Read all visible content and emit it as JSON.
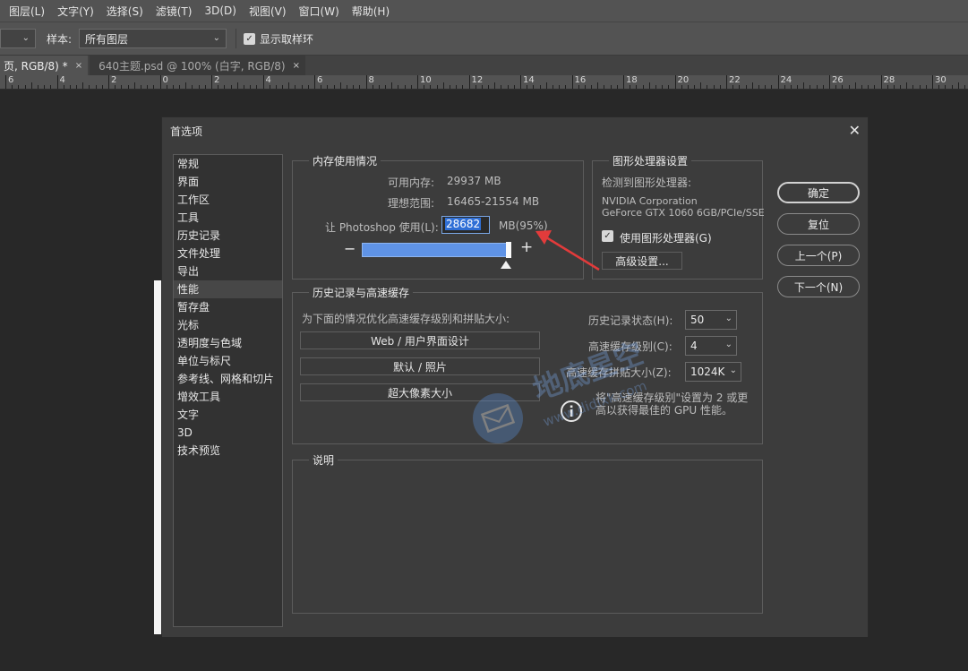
{
  "menubar": {
    "items": [
      "图层(L)",
      "文字(Y)",
      "选择(S)",
      "滤镜(T)",
      "3D(D)",
      "视图(V)",
      "窗口(W)",
      "帮助(H)"
    ]
  },
  "options": {
    "sample_label": "样本:",
    "sample_value": "所有图层",
    "show_ring_label": "显示取样环"
  },
  "tabs": [
    {
      "label": "页, RGB/8) *",
      "close": "×"
    },
    {
      "label": "640主题.psd @ 100% (白字, RGB/8)",
      "close": "×"
    }
  ],
  "ruler": {
    "labels": [
      "6",
      "4",
      "2",
      "0",
      "2",
      "4",
      "6",
      "8",
      "10",
      "12",
      "14",
      "16",
      "18",
      "20",
      "22",
      "24",
      "26",
      "28",
      "30"
    ]
  },
  "dialog": {
    "title": "首选项",
    "close": "✕",
    "nav": [
      "常规",
      "界面",
      "工作区",
      "工具",
      "历史记录",
      "文件处理",
      "导出",
      "性能",
      "暂存盘",
      "光标",
      "透明度与色域",
      "单位与标尺",
      "参考线、网格和切片",
      "增效工具",
      "文字",
      "3D",
      "技术预览"
    ],
    "nav_selected_index": 7,
    "memory": {
      "title": "内存使用情况",
      "available_label": "可用内存:",
      "available_value": "29937 MB",
      "ideal_label": "理想范围:",
      "ideal_value": "16465-21554 MB",
      "let_label": "让 Photoshop 使用(L):",
      "let_value": "28682",
      "let_unit": "MB(95%)",
      "minus": "−",
      "plus": "+",
      "slider_level": 0.95
    },
    "gpu": {
      "title": "图形处理器设置",
      "detected_label": "检测到图形处理器:",
      "vendor": "NVIDIA Corporation",
      "model": "GeForce GTX 1060 6GB/PCIe/SSE",
      "use_gpu_label": "使用图形处理器(G)",
      "advanced_button": "高级设置..."
    },
    "history": {
      "title": "历史记录与高速缓存",
      "optimize_label": "为下面的情况优化高速缓存级别和拼贴大小:",
      "buttons": [
        "Web / 用户界面设计",
        "默认 / 照片",
        "超大像素大小"
      ],
      "states_label": "历史记录状态(H):",
      "states_value": "50",
      "levels_label": "高速缓存级别(C):",
      "levels_value": "4",
      "tile_label": "高速缓存拼贴大小(Z):",
      "tile_value": "1024K",
      "info_line1": "将\"高速缓存级别\"设置为 2 或更",
      "info_line2": "高以获得最佳的 GPU 性能。"
    },
    "description": {
      "title": "说明"
    },
    "buttons": {
      "ok": "确定",
      "reset": "复位",
      "prev": "上一个(P)",
      "next": "下一个(N)"
    }
  },
  "watermark": {
    "text": "地底星空",
    "url": "www.didixk.com"
  },
  "colors": {
    "slider": "#5f93e6",
    "highlight": "#2f6fd6",
    "arrow": "#e23b3b"
  }
}
